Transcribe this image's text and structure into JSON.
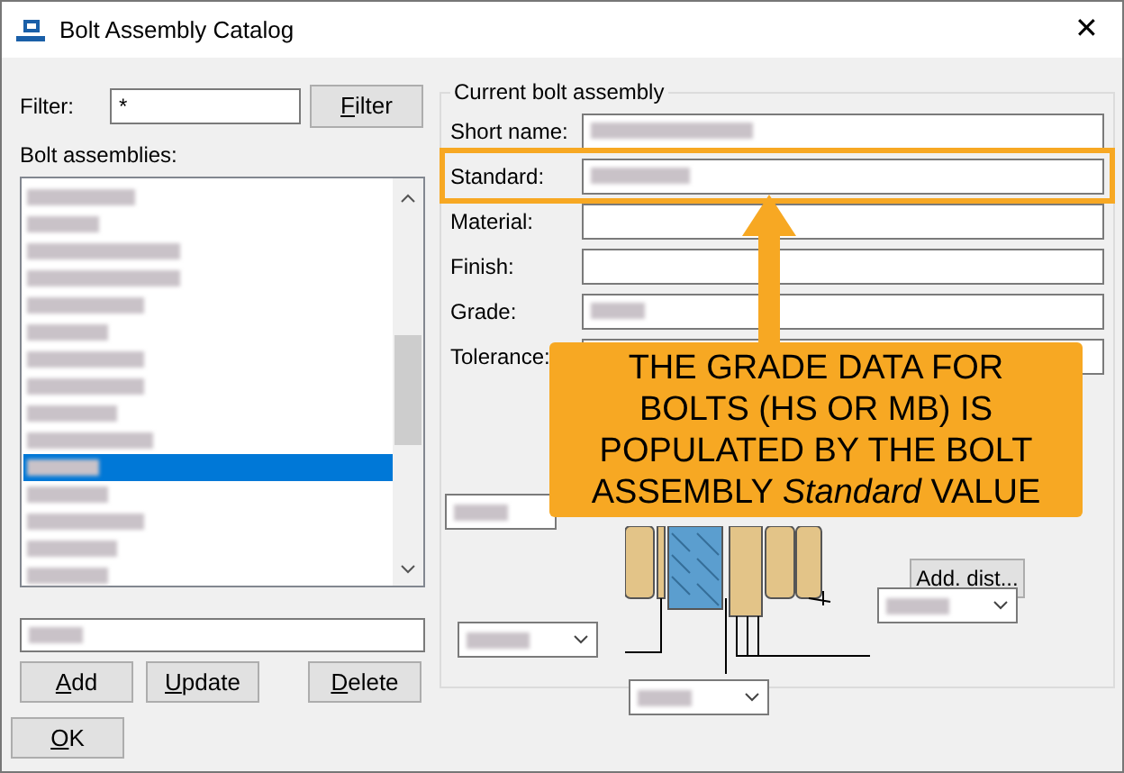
{
  "window": {
    "title": "Bolt Assembly Catalog",
    "close": "✕"
  },
  "filter": {
    "label": "Filter:",
    "value": "*",
    "button": "Filter"
  },
  "list": {
    "label": "Bolt assemblies:",
    "items": [
      {
        "selected": false
      },
      {
        "selected": false
      },
      {
        "selected": false
      },
      {
        "selected": false
      },
      {
        "selected": false
      },
      {
        "selected": false
      },
      {
        "selected": false
      },
      {
        "selected": false
      },
      {
        "selected": false
      },
      {
        "selected": false
      },
      {
        "selected": true
      },
      {
        "selected": false
      },
      {
        "selected": false
      },
      {
        "selected": false
      },
      {
        "selected": false
      }
    ]
  },
  "list_buttons": [
    "Add",
    "Update",
    "Delete"
  ],
  "ok_button": "OK",
  "group": {
    "title": "Current bolt assembly",
    "fields": [
      {
        "label": "Short name:",
        "redacted": true,
        "highlighted": false
      },
      {
        "label": "Standard:",
        "redacted": true,
        "highlighted": true
      },
      {
        "label": "Material:",
        "redacted": false,
        "highlighted": false
      },
      {
        "label": "Finish:",
        "redacted": false,
        "highlighted": false
      },
      {
        "label": "Grade:",
        "redacted": true,
        "highlighted": false
      },
      {
        "label": "Tolerance:",
        "highlighted": false
      }
    ],
    "add_dist_button": "Add. dist..."
  },
  "callout": {
    "text": "THE GRADE DATA FOR BOLTS (HS OR MB) IS POPULATED BY THE BOLT ASSEMBLY *Standard* VALUE"
  }
}
